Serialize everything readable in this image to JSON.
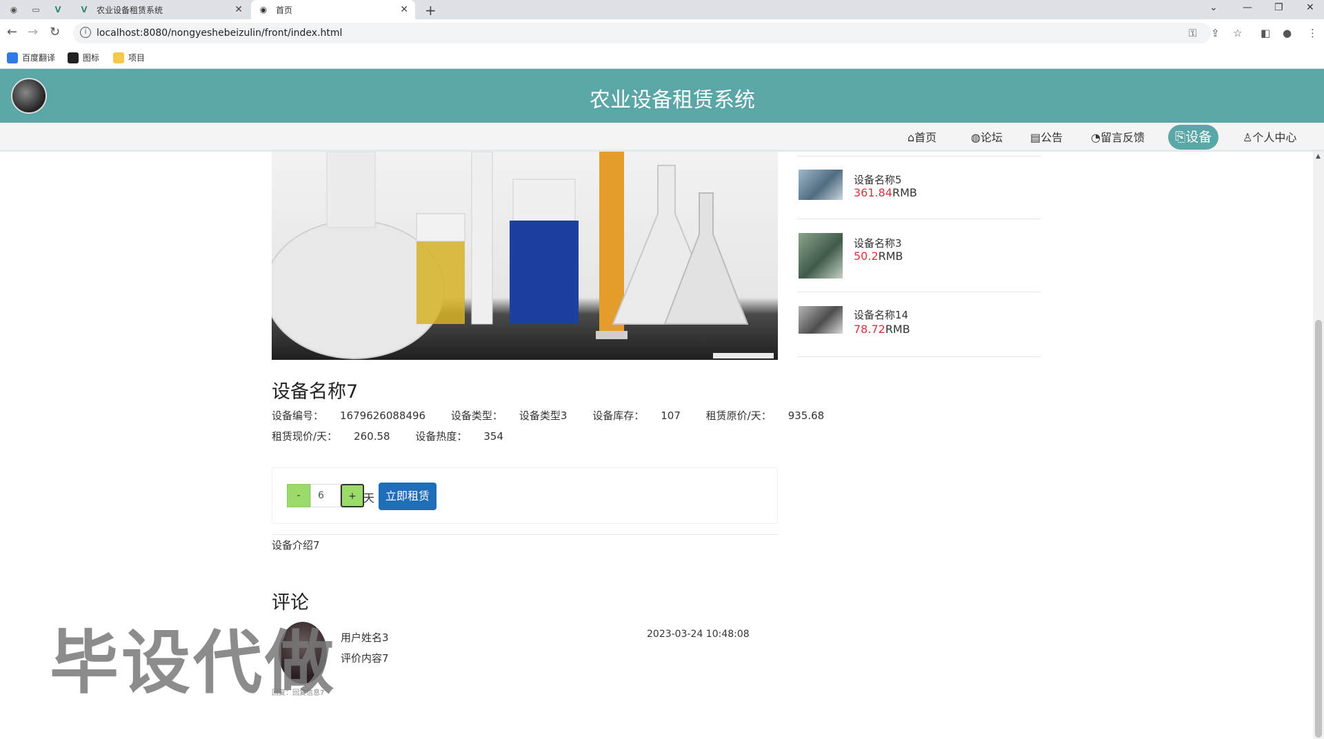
{
  "browser": {
    "tabs": [
      {
        "title": "农业设备租赁系统",
        "icon": "vue-logo-icon",
        "active": false
      },
      {
        "title": "首页",
        "icon": "globe-icon",
        "active": true
      }
    ],
    "url": "localhost:8080/nongyeshebeizulin/front/index.html",
    "bookmarks": [
      {
        "label": "百度翻译",
        "icon": "translate-icon"
      },
      {
        "label": "图标",
        "icon": "image-icon"
      },
      {
        "label": "项目",
        "icon": "folder-icon"
      }
    ]
  },
  "site": {
    "title": "农业设备租赁系统",
    "nav": [
      {
        "label": "首页",
        "icon": "⌂",
        "active": false
      },
      {
        "label": "论坛",
        "icon": "◍",
        "active": false
      },
      {
        "label": "公告",
        "icon": "▤",
        "active": false
      },
      {
        "label": "留言反馈",
        "icon": "◔",
        "active": false
      },
      {
        "label": "设备",
        "icon": "⎘",
        "active": true
      },
      {
        "label": "个人中心",
        "icon": "♙",
        "active": false
      }
    ]
  },
  "product": {
    "name": "设备名称7",
    "attrs_line1": [
      {
        "label": "设备编号：",
        "value": "1679626088496"
      },
      {
        "label": "设备类型：",
        "value": "设备类型3"
      },
      {
        "label": "设备库存：",
        "value": "107"
      },
      {
        "label": "租赁原价/天：",
        "value": "935.68"
      }
    ],
    "attrs_line2": [
      {
        "label": "租赁现价/天：",
        "value": "260.58"
      },
      {
        "label": "设备热度：",
        "value": "354"
      }
    ],
    "rent": {
      "minus": "-",
      "plus": "+",
      "days": "6",
      "unit": "天",
      "button": "立即租赁"
    },
    "intro": "设备介绍7"
  },
  "comments": {
    "title": "评论",
    "items": [
      {
        "user": "用户姓名3",
        "content": "评价内容7",
        "time": "2023-03-24 10:48:08",
        "reply": "回复：回复信息7"
      }
    ]
  },
  "sidebar": {
    "items": [
      {
        "name": "设备名称5",
        "price": "361.84",
        "currency": "RMB"
      },
      {
        "name": "设备名称3",
        "price": "50.2",
        "currency": "RMB"
      },
      {
        "name": "设备名称14",
        "price": "78.72",
        "currency": "RMB"
      }
    ]
  },
  "watermark": "毕设代做",
  "colors": {
    "primary": "#5ba7a8",
    "price": "#d9333f",
    "rent_button": "#1e6fb8",
    "stepper": "#9bdb6a"
  }
}
